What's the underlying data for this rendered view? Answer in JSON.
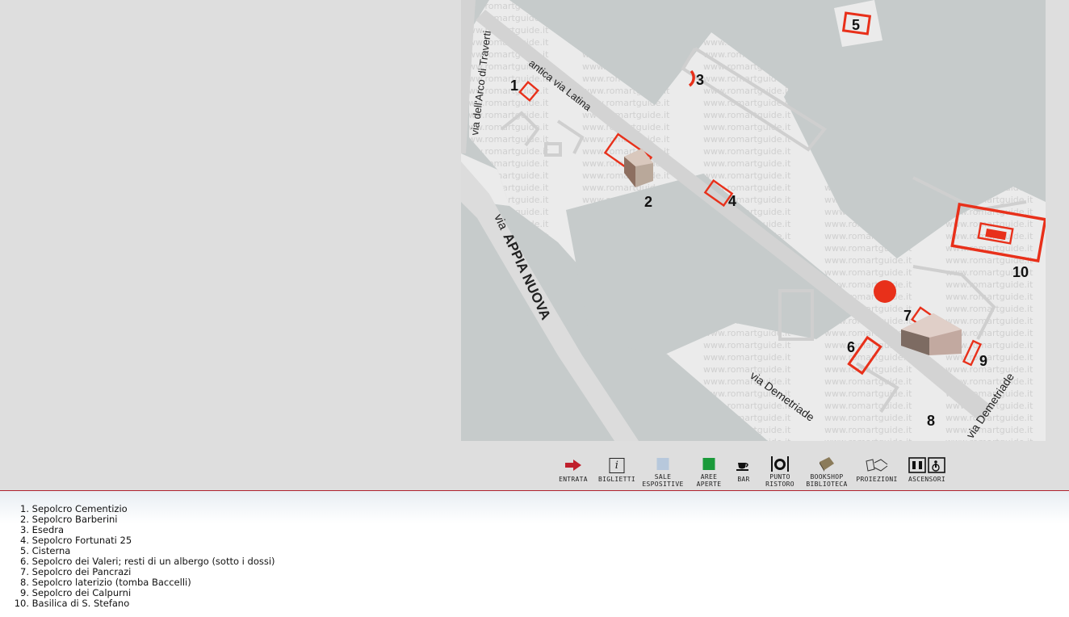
{
  "map": {
    "watermark": "www.romartguide.it",
    "streets": {
      "arco": "via dell'Arco di Traverti",
      "latina": "antica via Latina",
      "appia_prefix": "via",
      "appia": "APPIA NUOVA",
      "demetriade_1": "via Demetriade",
      "demetriade_2": "via Demetriade"
    },
    "markers": [
      "1",
      "2",
      "3",
      "4",
      "5",
      "6",
      "7",
      "8",
      "9",
      "10"
    ],
    "accent": "#e8301a"
  },
  "legend": [
    {
      "label1": "ENTRATA",
      "label2": "",
      "icon": "entrance-arrow-icon"
    },
    {
      "label1": "BIGLIETTI",
      "label2": "",
      "icon": "info-icon",
      "glyph": "i"
    },
    {
      "label1": "SALE",
      "label2": "ESPOSITIVE",
      "icon": "exhibition-halls-icon"
    },
    {
      "label1": "AREE",
      "label2": "APERTE",
      "icon": "open-areas-icon"
    },
    {
      "label1": "BAR",
      "label2": "",
      "icon": "coffee-cup-icon"
    },
    {
      "label1": "PUNTO",
      "label2": "RISTORO",
      "icon": "restaurant-icon"
    },
    {
      "label1": "BOOKSHOP",
      "label2": "BIBLIOTECA",
      "icon": "book-icon"
    },
    {
      "label1": "PROIEZIONI",
      "label2": "",
      "icon": "projection-icon"
    },
    {
      "label1": "ASCENSORI",
      "label2": "",
      "icon": "elevator-icon"
    }
  ],
  "colors": {
    "entrance": "#c0202c",
    "exhibition": "#b7c8dc",
    "open_area": "#1a9a3a",
    "divider": "#b0242f"
  },
  "poi_list": [
    {
      "num": "1.",
      "name": "Sepolcro Cementizio"
    },
    {
      "num": "2.",
      "name": "Sepolcro Barberini"
    },
    {
      "num": "3.",
      "name": "Esedra"
    },
    {
      "num": "4.",
      "name": "Sepolcro Fortunati 25"
    },
    {
      "num": "5.",
      "name": "Cisterna"
    },
    {
      "num": "6.",
      "name": "Sepolcro dei Valeri; resti di un albergo (sotto i dossi)"
    },
    {
      "num": "7.",
      "name": "Sepolcro dei Pancrazi"
    },
    {
      "num": "8.",
      "name": "Sepolcro laterizio (tomba Baccelli)"
    },
    {
      "num": "9.",
      "name": "Sepolcro dei Calpurni"
    },
    {
      "num": "10.",
      "name": "Basilica di S. Stefano"
    }
  ]
}
